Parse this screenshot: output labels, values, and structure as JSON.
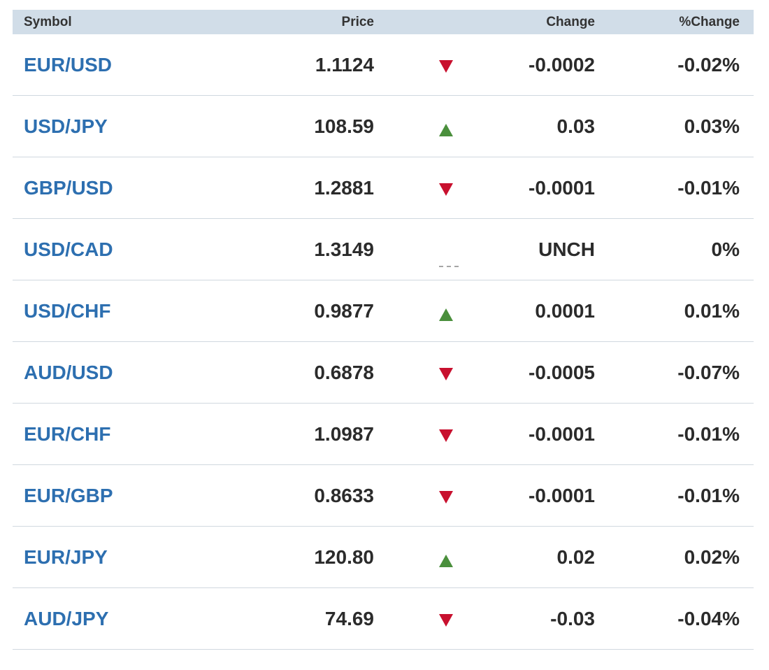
{
  "header": {
    "symbol": "Symbol",
    "price": "Price",
    "change": "Change",
    "pct_change": "%Change"
  },
  "colors": {
    "header_bg": "#d1dde8",
    "symbol_link": "#2d6fb0",
    "down": "#c8102e",
    "up": "#4a8f3c",
    "unchanged": "#a6a6a6"
  },
  "rows": [
    {
      "symbol": "EUR/USD",
      "price": "1.1124",
      "direction": "down",
      "change": "-0.0002",
      "pct": "-0.02%"
    },
    {
      "symbol": "USD/JPY",
      "price": "108.59",
      "direction": "up",
      "change": "0.03",
      "pct": "0.03%"
    },
    {
      "symbol": "GBP/USD",
      "price": "1.2881",
      "direction": "down",
      "change": "-0.0001",
      "pct": "-0.01%"
    },
    {
      "symbol": "USD/CAD",
      "price": "1.3149",
      "direction": "unch",
      "change": "UNCH",
      "pct": "0%"
    },
    {
      "symbol": "USD/CHF",
      "price": "0.9877",
      "direction": "up",
      "change": "0.0001",
      "pct": "0.01%"
    },
    {
      "symbol": "AUD/USD",
      "price": "0.6878",
      "direction": "down",
      "change": "-0.0005",
      "pct": "-0.07%"
    },
    {
      "symbol": "EUR/CHF",
      "price": "1.0987",
      "direction": "down",
      "change": "-0.0001",
      "pct": "-0.01%"
    },
    {
      "symbol": "EUR/GBP",
      "price": "0.8633",
      "direction": "down",
      "change": "-0.0001",
      "pct": "-0.01%"
    },
    {
      "symbol": "EUR/JPY",
      "price": "120.80",
      "direction": "up",
      "change": "0.02",
      "pct": "0.02%"
    },
    {
      "symbol": "AUD/JPY",
      "price": "74.69",
      "direction": "down",
      "change": "-0.03",
      "pct": "-0.04%"
    }
  ]
}
